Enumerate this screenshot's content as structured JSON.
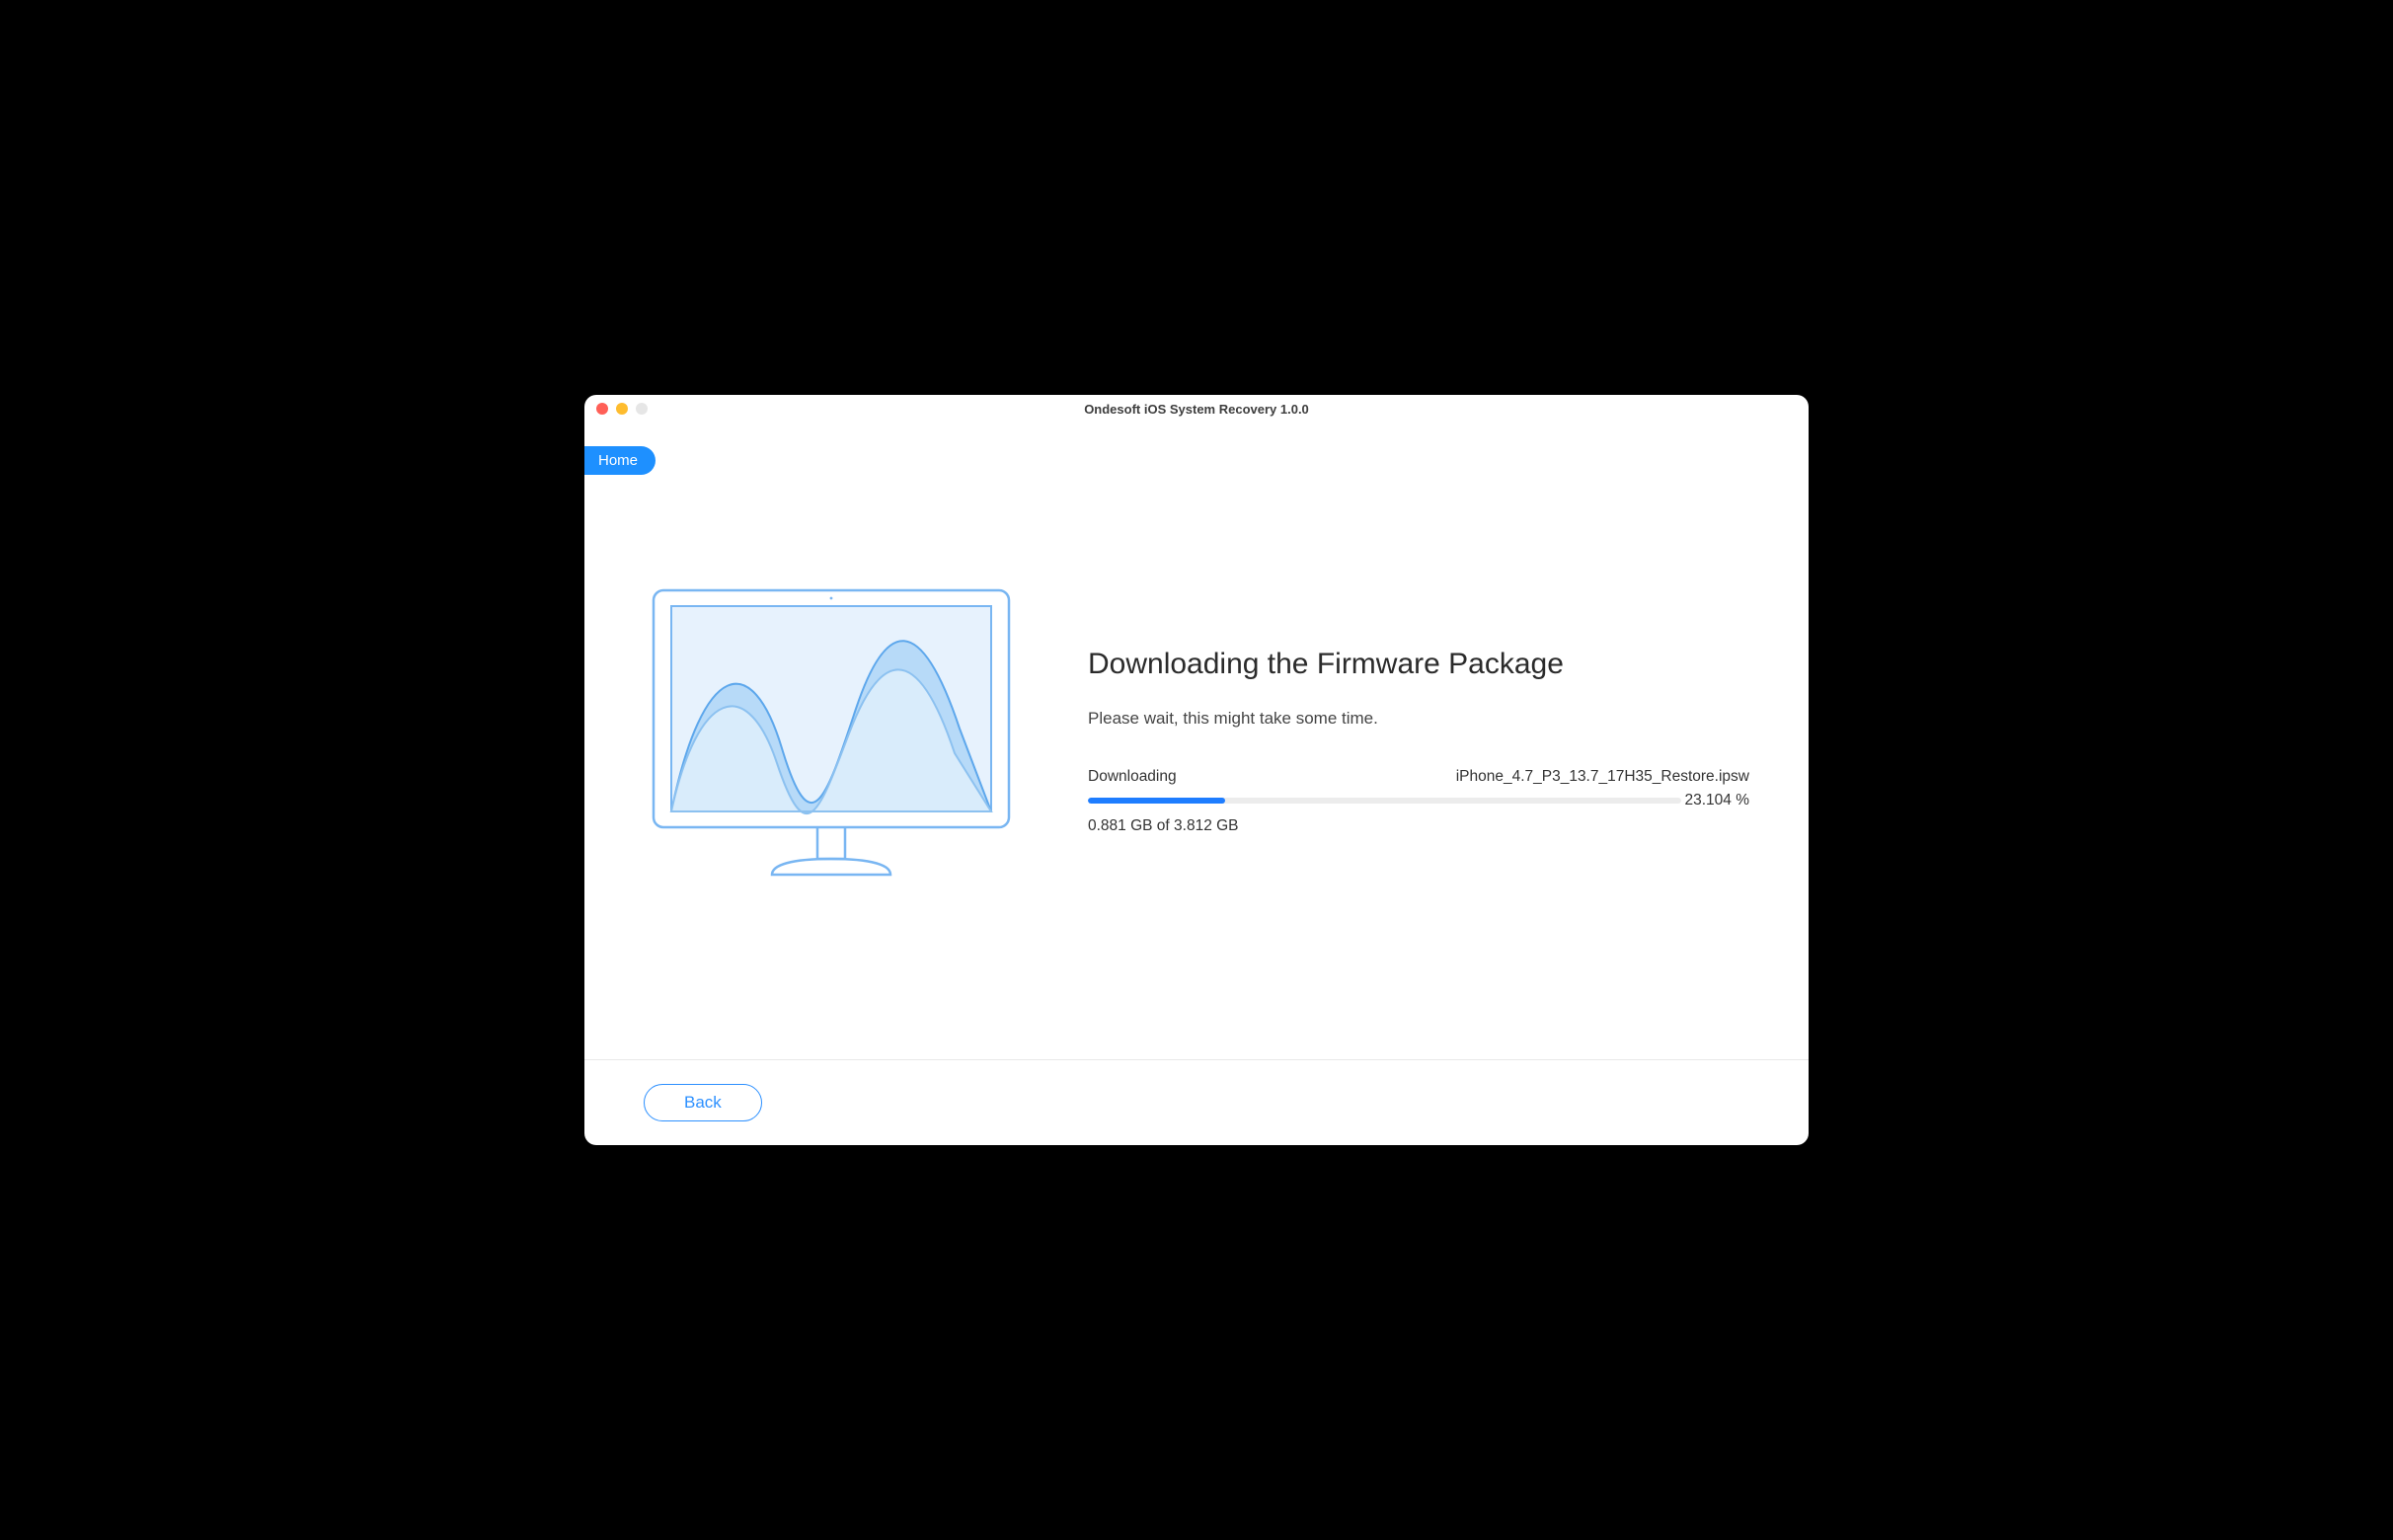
{
  "window": {
    "title": "Ondesoft iOS System Recovery 1.0.0"
  },
  "nav": {
    "home_label": "Home"
  },
  "main": {
    "heading": "Downloading the Firmware Package",
    "subtitle": "Please wait, this might take some time.",
    "status_label": "Downloading",
    "filename": "iPhone_4.7_P3_13.7_17H35_Restore.ipsw",
    "percent_text": "23.104 %",
    "percent_value": 23.104,
    "bytes_text": "0.881 GB of 3.812 GB"
  },
  "footer": {
    "back_label": "Back"
  }
}
